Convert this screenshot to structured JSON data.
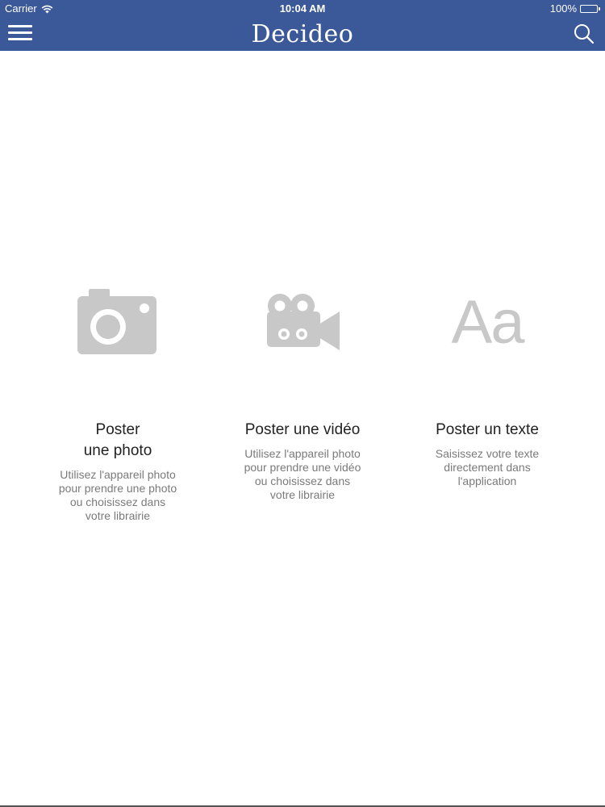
{
  "status_bar": {
    "carrier": "Carrier",
    "time": "10:04 AM",
    "battery": "100%",
    "wifi_icon": "wifi-icon",
    "battery_icon": "battery-icon"
  },
  "nav": {
    "title": "Decideo",
    "menu_icon": "hamburger-menu-icon",
    "search_icon": "search-icon"
  },
  "colors": {
    "nav_background": "#3b5998",
    "icon_gray": "#c8c8c8",
    "battery_green": "#4cd964"
  },
  "options": {
    "photo": {
      "icon": "camera-icon",
      "title": "Poster\nune photo",
      "description": "Utilisez l'appareil photo pour prendre une photo ou choisissez dans votre librairie"
    },
    "video": {
      "icon": "video-camera-icon",
      "title": "Poster une vidéo",
      "description": "Utilisez l'appareil photo pour prendre une vidéo ou choisissez dans votre librairie"
    },
    "text": {
      "icon": "text-aa-icon",
      "glyph": "Aa",
      "title": "Poster un texte",
      "description": "Saisissez votre texte directement dans l'application"
    }
  }
}
